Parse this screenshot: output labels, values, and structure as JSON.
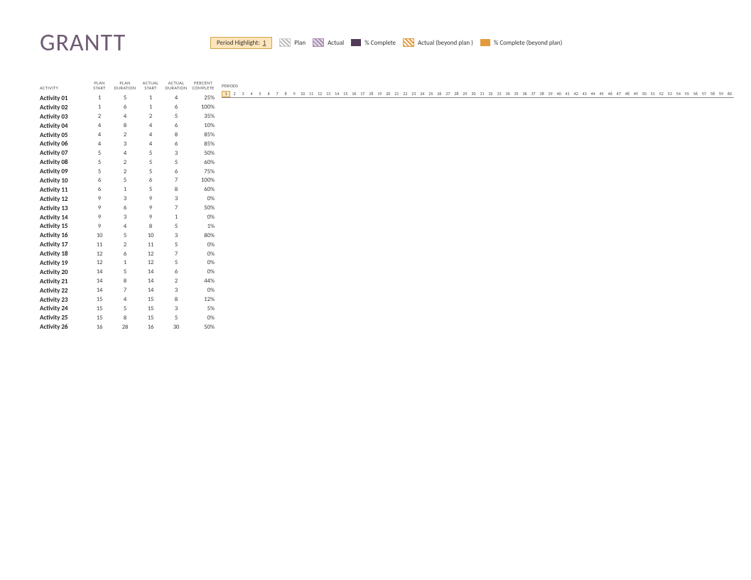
{
  "title": "GRANTT",
  "legend": {
    "highlight_label": "Period Highlight:",
    "highlight_value": "1",
    "plan": "Plan",
    "actual": "Actual",
    "complete": "% Complete",
    "actual_beyond": "Actual (beyond plan )",
    "complete_beyond": "% Complete (beyond plan)"
  },
  "headers": {
    "activity": "ACTIVITY",
    "plan_start": "PLAN\nSTART",
    "plan_duration": "PLAN\nDURATION",
    "actual_start": "ACTUAL\nSTART",
    "actual_duration": "ACTUAL\nDURATION",
    "percent": "PERCENT\nCOMPLETE",
    "periods": "PERIODS"
  },
  "periods": {
    "from": 1,
    "to": 60,
    "highlight": 1
  },
  "rows": [
    {
      "act": "Activity 01",
      "ps": 1,
      "pd": 5,
      "as": 1,
      "ad": 4,
      "pc": "25%"
    },
    {
      "act": "Activity 02",
      "ps": 1,
      "pd": 6,
      "as": 1,
      "ad": 6,
      "pc": "100%"
    },
    {
      "act": "Activity 03",
      "ps": 2,
      "pd": 4,
      "as": 2,
      "ad": 5,
      "pc": "35%"
    },
    {
      "act": "Activity 04",
      "ps": 4,
      "pd": 8,
      "as": 4,
      "ad": 6,
      "pc": "10%"
    },
    {
      "act": "Activity 05",
      "ps": 4,
      "pd": 2,
      "as": 4,
      "ad": 8,
      "pc": "85%"
    },
    {
      "act": "Activity 06",
      "ps": 4,
      "pd": 3,
      "as": 4,
      "ad": 6,
      "pc": "85%"
    },
    {
      "act": "Activity 07",
      "ps": 5,
      "pd": 4,
      "as": 5,
      "ad": 3,
      "pc": "50%"
    },
    {
      "act": "Activity 08",
      "ps": 5,
      "pd": 2,
      "as": 5,
      "ad": 5,
      "pc": "60%"
    },
    {
      "act": "Activity 09",
      "ps": 5,
      "pd": 2,
      "as": 5,
      "ad": 6,
      "pc": "75%"
    },
    {
      "act": "Activity 10",
      "ps": 6,
      "pd": 5,
      "as": 6,
      "ad": 7,
      "pc": "100%"
    },
    {
      "act": "Activity 11",
      "ps": 6,
      "pd": 1,
      "as": 5,
      "ad": 8,
      "pc": "60%"
    },
    {
      "act": "Activity 12",
      "ps": 9,
      "pd": 3,
      "as": 9,
      "ad": 3,
      "pc": "0%"
    },
    {
      "act": "Activity 13",
      "ps": 9,
      "pd": 6,
      "as": 9,
      "ad": 7,
      "pc": "50%"
    },
    {
      "act": "Activity 14",
      "ps": 9,
      "pd": 3,
      "as": 9,
      "ad": 1,
      "pc": "0%"
    },
    {
      "act": "Activity 15",
      "ps": 9,
      "pd": 4,
      "as": 8,
      "ad": 5,
      "pc": "1%"
    },
    {
      "act": "Activity 16",
      "ps": 10,
      "pd": 5,
      "as": 10,
      "ad": 3,
      "pc": "80%"
    },
    {
      "act": "Activity 17",
      "ps": 11,
      "pd": 2,
      "as": 11,
      "ad": 5,
      "pc": "0%"
    },
    {
      "act": "Activity 18",
      "ps": 12,
      "pd": 6,
      "as": 12,
      "ad": 7,
      "pc": "0%"
    },
    {
      "act": "Activity 19",
      "ps": 12,
      "pd": 1,
      "as": 12,
      "ad": 5,
      "pc": "0%"
    },
    {
      "act": "Activity 20",
      "ps": 14,
      "pd": 5,
      "as": 14,
      "ad": 6,
      "pc": "0%"
    },
    {
      "act": "Activity 21",
      "ps": 14,
      "pd": 8,
      "as": 14,
      "ad": 2,
      "pc": "44%"
    },
    {
      "act": "Activity 22",
      "ps": 14,
      "pd": 7,
      "as": 14,
      "ad": 3,
      "pc": "0%"
    },
    {
      "act": "Activity 23",
      "ps": 15,
      "pd": 4,
      "as": 15,
      "ad": 8,
      "pc": "12%"
    },
    {
      "act": "Activity 24",
      "ps": 15,
      "pd": 5,
      "as": 15,
      "ad": 3,
      "pc": "5%"
    },
    {
      "act": "Activity 25",
      "ps": 15,
      "pd": 8,
      "as": 15,
      "ad": 5,
      "pc": "0%"
    },
    {
      "act": "Activity 26",
      "ps": 16,
      "pd": 28,
      "as": 16,
      "ad": 30,
      "pc": "50%"
    }
  ]
}
